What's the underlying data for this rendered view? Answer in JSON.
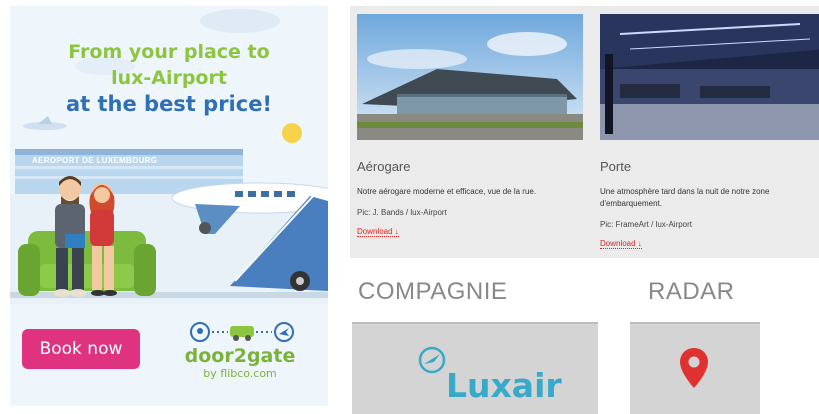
{
  "ad": {
    "headline_line1": "From your place to",
    "headline_line2": "lux-Airport",
    "headline_line3": "at the best price!",
    "building_sign": "AEROPORT DE LUXEMBOURG",
    "cta_label": "Book now",
    "brand_name": "door2gate",
    "brand_byline": "by flibco.com",
    "colors": {
      "green": "#8cc63f",
      "blue": "#2f6fb5",
      "pink": "#e0337f"
    }
  },
  "cards": [
    {
      "title": "Aérogare",
      "description": "Notre aérogare moderne et efficace, vue de la rue.",
      "credit": "Pic: J. Bands / lux-Airport",
      "download_label": "Download ↓"
    },
    {
      "title": "Porte",
      "description_line1": "Une atmosphère tard dans la nuit de notre zone",
      "description_line2": "d'embarquement.",
      "credit": "Pic: FrameArt / lux-Airport",
      "download_label": "Download ↓"
    }
  ],
  "sections": {
    "compagnie": "COMPAGNIE",
    "radar": "RADAR",
    "luxair_logo_text": "Luxair"
  }
}
